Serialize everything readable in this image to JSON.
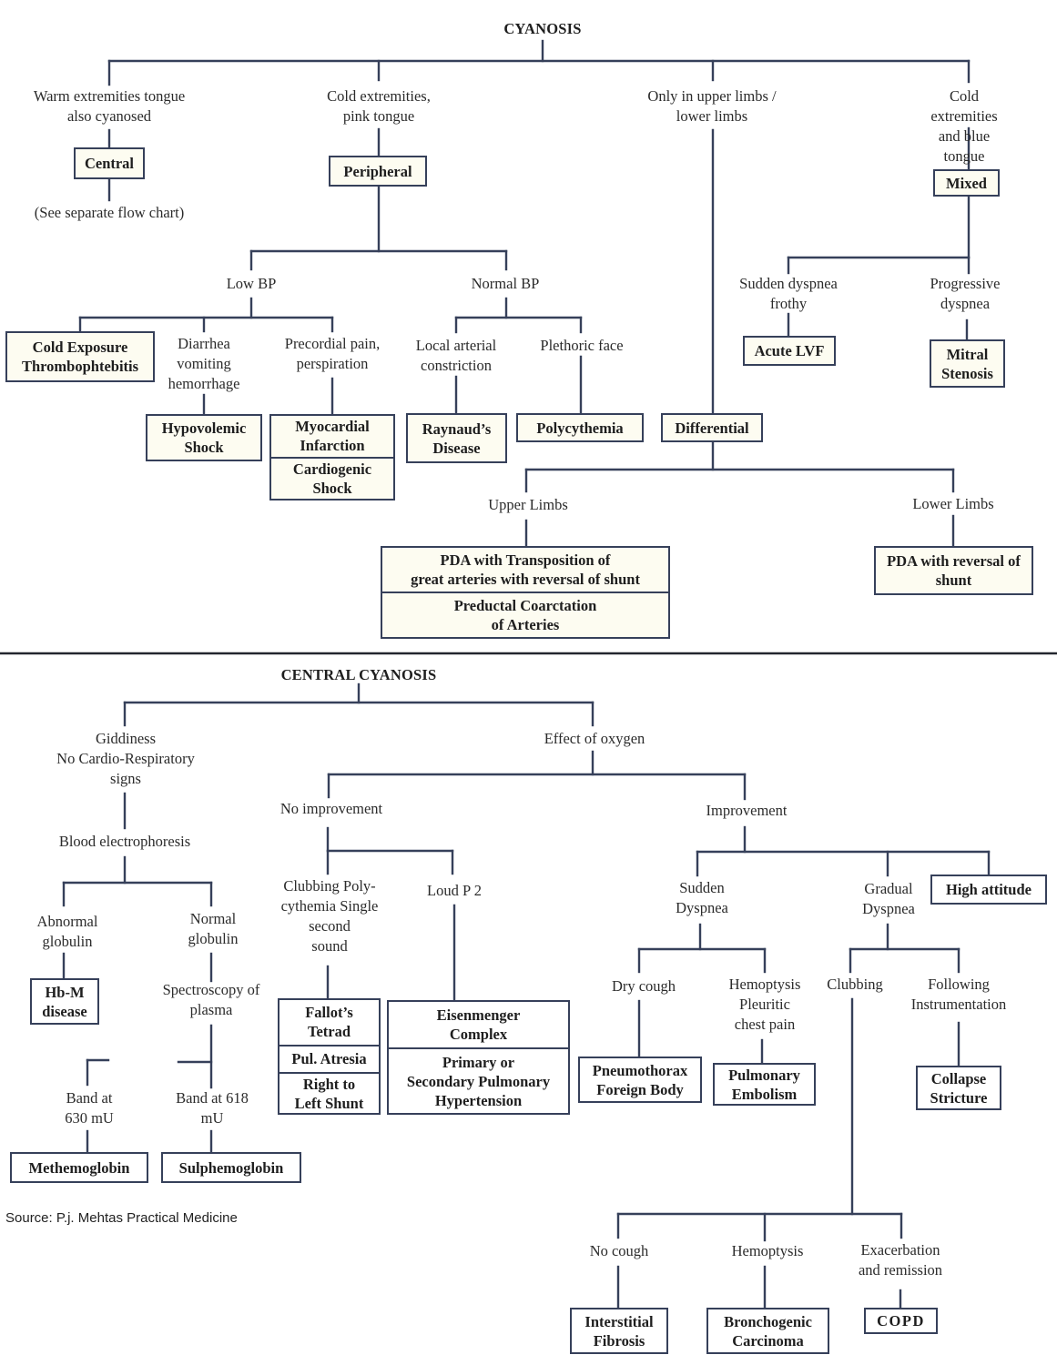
{
  "peripheral_chart": {
    "title": "CYANOSIS",
    "branches": {
      "warm": "Warm extremities tongue\nalso cyanosed",
      "cold_pink": "Cold extremities,\npink tongue",
      "limbs": "Only in upper limbs /\nlower limbs",
      "cold_blue": "Cold extremities\nand blue tongue"
    },
    "central_box": "Central",
    "central_note": "(See separate flow chart)",
    "peripheral_box": "Peripheral",
    "mixed_box": "Mixed",
    "low_bp": "Low BP",
    "normal_bp": "Normal BP",
    "cold_exposure_box": "Cold Exposure\nThrombophtebitis",
    "diarrhea": "Diarrhea\nvomiting\nhemorrhage",
    "precordial": "Precordial pain,\nperspiration",
    "hypovolemic_box": "Hypovolemic\nShock",
    "mi_box": "Myocardial\nInfarction",
    "cardiogenic_box": "Cardiogenic\nShock",
    "local_arterial": "Local arterial\nconstriction",
    "plethoric": "Plethoric face",
    "raynaud_box": "Raynaud’s\nDisease",
    "polycythemia_box": "Polycythemia",
    "differential_box": "Differential",
    "sudden_dyspnea": "Sudden dyspnea\nfrothy",
    "progressive_dyspnea": "Progressive\ndyspnea",
    "acute_lvf_box": "Acute LVF",
    "mitral_box": "Mitral\nStenosis",
    "upper_limbs": "Upper Limbs",
    "lower_limbs": "Lower Limbs",
    "pda_transposition_box": "PDA with Transposition of\ngreat arteries with reversal of shunt",
    "preductal_box": "Preductal Coarctation\nof Arteries",
    "pda_reversal_box": "PDA with reversal of\nshunt"
  },
  "central_chart": {
    "title": "CENTRAL CYANOSIS",
    "giddiness": "Giddiness\nNo Cardio-Respiratory\nsigns",
    "effect_oxygen": "Effect of oxygen",
    "blood_electro": "Blood electrophoresis",
    "abnormal_globulin": "Abnormal\nglobulin",
    "normal_globulin": "Normal\nglobulin",
    "hbm_box": "Hb-M\ndisease",
    "spectroscopy": "Spectroscopy of\nplasma",
    "band_630": "Band at\n630 mU",
    "band_618": "Band at 618\nmU",
    "methemoglobin_box": "Methemoglobin",
    "sulphemoglobin_box": "Sulphemoglobin",
    "no_improvement": "No improvement",
    "improvement": "Improvement",
    "clubbing_poly": "Clubbing Poly-\ncythemia Single\nsecond\nsound",
    "loud_p2": "Loud P 2",
    "fallot_box": "Fallot’s\nTetrad",
    "pul_atresia_box": "Pul. Atresia",
    "right_left_box": "Right to\nLeft Shunt",
    "eisenmenger_box": "Eisenmenger\nComplex",
    "pulm_htn_box": "Primary or\nSecondary Pulmonary\nHypertension",
    "sudden_dyspnea": "Sudden\nDyspnea",
    "gradual_dyspnea": "Gradual\nDyspnea",
    "high_attitude_box": "High attitude",
    "dry_cough": "Dry cough",
    "hemoptysis_pleuritic": "Hemoptysis\nPleuritic\nchest pain",
    "clubbing": "Clubbing",
    "following_instr": "Following\nInstrumentation",
    "pneumothorax_box": "Pneumothorax\nForeign Body",
    "pulm_embolism_box": "Pulmonary\nEmbolism",
    "collapse_box": "Collapse\nStricture",
    "no_cough": "No cough",
    "hemoptysis": "Hemoptysis",
    "exacerbation": "Exacerbation\nand remission",
    "interstitial_box": "Interstitial\nFibrosis",
    "bronchogenic_box": "Bronchogenic\nCarcinoma",
    "copd_box": "COPD"
  },
  "source": "Source: P.j. Mehtas Practical Medicine"
}
